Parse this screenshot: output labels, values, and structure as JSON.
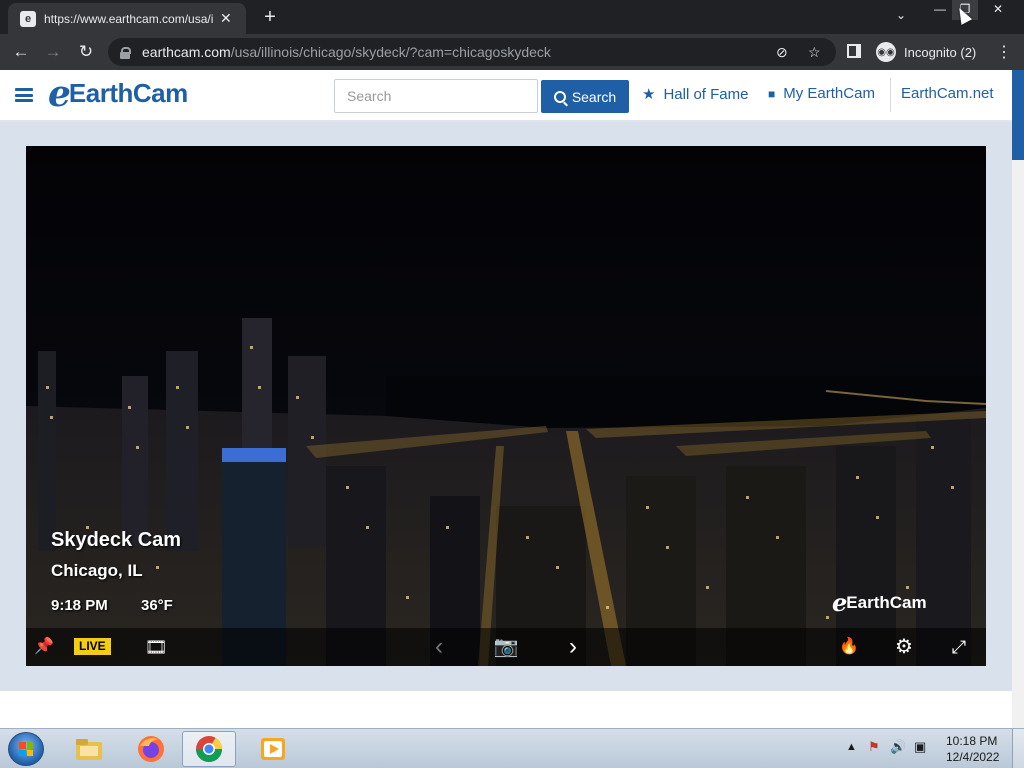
{
  "browser": {
    "tab_title": "https://www.earthcam.com/usa/i",
    "tab_close": "✕",
    "new_tab": "+",
    "tab_search": "⌄",
    "window_controls": {
      "minimize": "—",
      "restore": "❐",
      "close": "✕"
    },
    "back": "←",
    "forward": "→",
    "reload": "↻",
    "url_host": "earthcam.com",
    "url_path": "/usa/illinois/chicago/skydeck/?cam=chicagoskydeck",
    "eye_icon": "⊘",
    "star": "☆",
    "incognito_label": "Incognito (2)",
    "incognito_glyph": "◉◉",
    "menu": "⋮"
  },
  "site": {
    "logo_mark": "e",
    "logo_text": "EarthCam",
    "search_placeholder": "Search",
    "search_button": "Search",
    "nav": {
      "hall_of_fame": "Hall of Fame",
      "hall_icon": "★",
      "my_earthcam": "My EarthCam",
      "camera_icon": "■",
      "earthcam_net": "EarthCam.net"
    }
  },
  "player": {
    "title": "Skydeck Cam",
    "location": "Chicago, IL",
    "time": "9:18 PM",
    "temperature": "36°F",
    "watermark_mark": "e",
    "watermark_text": "EarthCam",
    "controls": {
      "pin": "📌",
      "live": "LIVE",
      "film": "🎞",
      "prev": "‹",
      "camera": "📷",
      "next": "›",
      "hot": "🔥",
      "settings": "⚙",
      "fullscreen": "⤢"
    }
  },
  "taskbar": {
    "clock_time": "10:18 PM",
    "clock_date": "12/4/2022",
    "tray_arrow": "▲",
    "tray_flag": "⚑",
    "tray_volume": "🔊",
    "tray_network": "▣"
  },
  "colors": {
    "brand": "#1f5fa5",
    "live_badge": "#f3cd12",
    "chrome_dark": "#202124",
    "chrome_tab": "#35363a"
  }
}
